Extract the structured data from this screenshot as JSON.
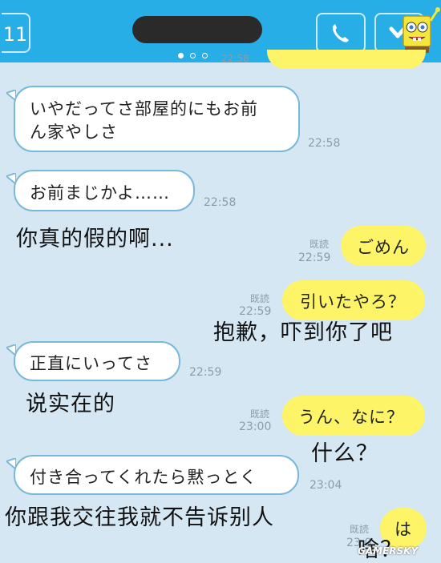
{
  "header": {
    "back_label": "11",
    "page_dots": 3,
    "active_dot": 0,
    "accent_color": "#28aee6"
  },
  "top_partial_time": "22:58",
  "messages": [
    {
      "id": "m1",
      "side": "left",
      "text_line1": "いやだってさ部屋的にもお前",
      "text_line2": "ん家やしさ",
      "time": "22:58"
    },
    {
      "id": "m2",
      "side": "left",
      "text": "お前まじかよ……",
      "time": "22:58"
    },
    {
      "id": "m3",
      "side": "right",
      "text": "ごめん",
      "read": "既読",
      "time": "22:59"
    },
    {
      "id": "m4",
      "side": "right",
      "text": "引いたやろ？",
      "read": "既読",
      "time": "22:59"
    },
    {
      "id": "m5",
      "side": "left",
      "text": "正直にいってさ",
      "time": "22:59"
    },
    {
      "id": "m6",
      "side": "right",
      "text": "うん、なに？",
      "read": "既読",
      "time": "23:00"
    },
    {
      "id": "m7",
      "side": "left",
      "text": "付き合ってくれたら黙っとく",
      "time": "23:04"
    },
    {
      "id": "m8",
      "side": "right",
      "text": "は",
      "read": "既読",
      "time": "23:0"
    }
  ],
  "overlays": {
    "o1": "你真的假的啊...",
    "o2": "抱歉，吓到你了吧",
    "o3": "说实在的",
    "o4": "什么？",
    "o5": "你跟我交往我就不告诉别人",
    "o6": "啥？"
  },
  "watermark": "GAMERSKY",
  "icons": [
    "phone-icon",
    "chevron-down-icon",
    "mascot-icon"
  ]
}
